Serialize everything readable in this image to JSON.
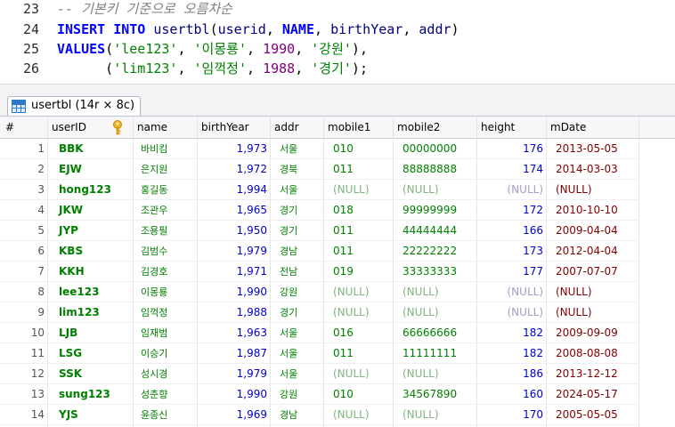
{
  "editor": {
    "lines": [
      {
        "num": "23",
        "tokens": [
          {
            "t": "-- 기본키 기준으로 오름차순",
            "c": "cm"
          }
        ]
      },
      {
        "num": "24",
        "tokens": [
          {
            "t": "INSERT",
            "c": "kw"
          },
          {
            "t": " ",
            "c": "punc"
          },
          {
            "t": "INTO",
            "c": "kw"
          },
          {
            "t": " ",
            "c": "punc"
          },
          {
            "t": "usertbl",
            "c": "ident"
          },
          {
            "t": "(",
            "c": "punc"
          },
          {
            "t": "userid",
            "c": "ident"
          },
          {
            "t": ", ",
            "c": "punc"
          },
          {
            "t": "NAME",
            "c": "kw"
          },
          {
            "t": ", ",
            "c": "punc"
          },
          {
            "t": "birthYear",
            "c": "ident"
          },
          {
            "t": ", ",
            "c": "punc"
          },
          {
            "t": "addr",
            "c": "ident"
          },
          {
            "t": ")",
            "c": "punc"
          }
        ]
      },
      {
        "num": "25",
        "tokens": [
          {
            "t": "VALUES",
            "c": "kw"
          },
          {
            "t": "(",
            "c": "punc"
          },
          {
            "t": "'lee123'",
            "c": "str"
          },
          {
            "t": ", ",
            "c": "punc"
          },
          {
            "t": "'이몽룡'",
            "c": "str"
          },
          {
            "t": ", ",
            "c": "punc"
          },
          {
            "t": "1990",
            "c": "num"
          },
          {
            "t": ", ",
            "c": "punc"
          },
          {
            "t": "'강원'",
            "c": "str"
          },
          {
            "t": "),",
            "c": "punc"
          }
        ]
      },
      {
        "num": "26",
        "tokens": [
          {
            "t": "      (",
            "c": "punc"
          },
          {
            "t": "'lim123'",
            "c": "str"
          },
          {
            "t": ", ",
            "c": "punc"
          },
          {
            "t": "'임꺽정'",
            "c": "str"
          },
          {
            "t": ", ",
            "c": "punc"
          },
          {
            "t": "1988",
            "c": "num"
          },
          {
            "t": ", ",
            "c": "punc"
          },
          {
            "t": "'경기'",
            "c": "str"
          },
          {
            "t": ");",
            "c": "punc"
          }
        ]
      }
    ]
  },
  "tab": {
    "label": "usertbl (14r × 8c)",
    "icon": "table-grid-icon"
  },
  "table": {
    "columns": [
      "#",
      "userID",
      "name",
      "birthYear",
      "addr",
      "mobile1",
      "mobile2",
      "height",
      "mDate"
    ],
    "key_icon": "primary-key-icon",
    "null_text": "(NULL)",
    "rows": [
      [
        "1",
        "BBK",
        "바비킴",
        "1,973",
        "서울",
        "010",
        "00000000",
        "176",
        "2013-05-05"
      ],
      [
        "2",
        "EJW",
        "은지원",
        "1,972",
        "경북",
        "011",
        "88888888",
        "174",
        "2014-03-03"
      ],
      [
        "3",
        "hong123",
        "홍길동",
        "1,994",
        "서울",
        "(NULL)",
        "(NULL)",
        "(NULL)",
        "(NULL)"
      ],
      [
        "4",
        "JKW",
        "조관우",
        "1,965",
        "경기",
        "018",
        "99999999",
        "172",
        "2010-10-10"
      ],
      [
        "5",
        "JYP",
        "조용필",
        "1,950",
        "경기",
        "011",
        "44444444",
        "166",
        "2009-04-04"
      ],
      [
        "6",
        "KBS",
        "김범수",
        "1,979",
        "경남",
        "011",
        "22222222",
        "173",
        "2012-04-04"
      ],
      [
        "7",
        "KKH",
        "김경호",
        "1,971",
        "전남",
        "019",
        "33333333",
        "177",
        "2007-07-07"
      ],
      [
        "8",
        "lee123",
        "이몽룡",
        "1,990",
        "강원",
        "(NULL)",
        "(NULL)",
        "(NULL)",
        "(NULL)"
      ],
      [
        "9",
        "lim123",
        "임꺽정",
        "1,988",
        "경기",
        "(NULL)",
        "(NULL)",
        "(NULL)",
        "(NULL)"
      ],
      [
        "10",
        "LJB",
        "임재범",
        "1,963",
        "서울",
        "016",
        "66666666",
        "182",
        "2009-09-09"
      ],
      [
        "11",
        "LSG",
        "이승기",
        "1,987",
        "서울",
        "011",
        "11111111",
        "182",
        "2008-08-08"
      ],
      [
        "12",
        "SSK",
        "성시경",
        "1,979",
        "서울",
        "(NULL)",
        "(NULL)",
        "186",
        "2013-12-12"
      ],
      [
        "13",
        "sung123",
        "성춘향",
        "1,990",
        "강원",
        "010",
        "34567890",
        "160",
        "2024-05-17"
      ],
      [
        "14",
        "YJS",
        "윤종신",
        "1,969",
        "경남",
        "(NULL)",
        "(NULL)",
        "170",
        "2005-05-05"
      ]
    ]
  }
}
